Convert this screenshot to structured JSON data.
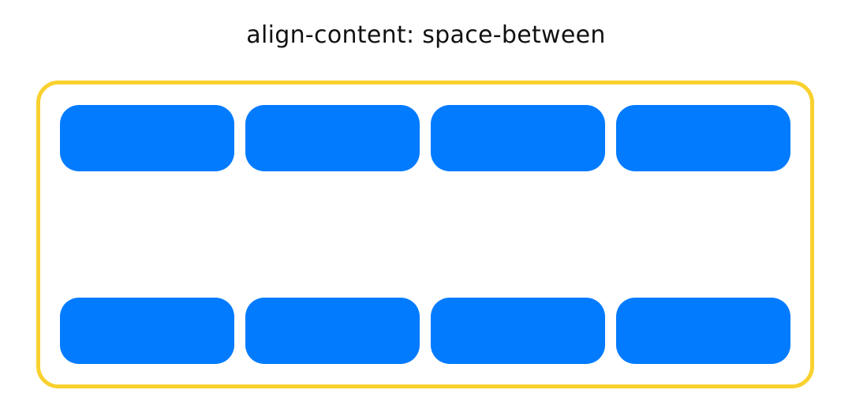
{
  "title": "align-content: space-between",
  "colors": {
    "container_border": "#f9d12f",
    "item_fill": "#027bff",
    "background": "#ffffff"
  },
  "container": {
    "rows": 2,
    "items_per_row": 4
  }
}
